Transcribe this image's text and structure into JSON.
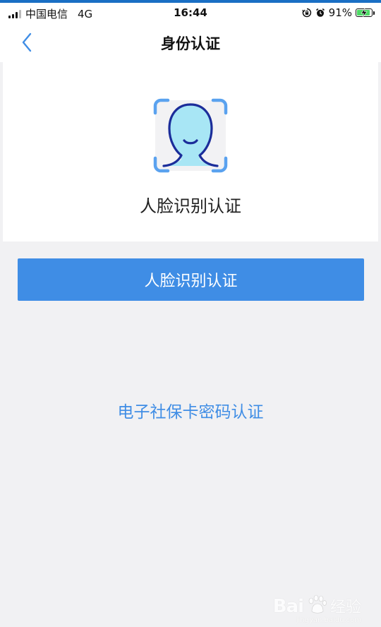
{
  "status_bar": {
    "carrier": "中国电信",
    "network": "4G",
    "time": "16:44",
    "battery": "91%",
    "battery_level": 0.91
  },
  "nav": {
    "title": "身份认证"
  },
  "face_card": {
    "label": "人脸识别认证"
  },
  "primary_button": {
    "label": "人脸识别认证"
  },
  "alt_link": {
    "label": "电子社保卡密码认证"
  },
  "watermark": {
    "logo": "Bai",
    "text": "经验",
    "url": "jingyan.baidu.com"
  },
  "colors": {
    "accent": "#3f8de5",
    "background": "#f1f1f3",
    "face_fill": "#a8e6f5",
    "face_stroke": "#1b2d9a",
    "frame_corner": "#5aa2ef"
  },
  "icons": [
    "signal-icon",
    "rotation-lock-icon",
    "alarm-icon",
    "battery-icon",
    "back-chevron-icon",
    "face-recognition-icon",
    "baidu-paw-icon"
  ]
}
